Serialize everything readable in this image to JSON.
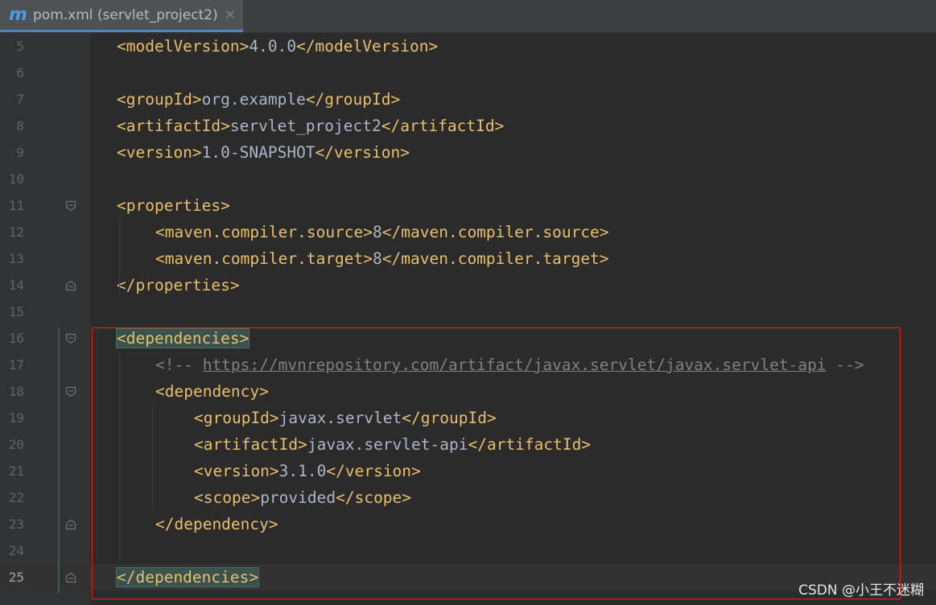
{
  "tab": {
    "icon": "m",
    "icon_name": "maven-file-icon",
    "title": "pom.xml (servlet_project2)",
    "close": "✕"
  },
  "editor": {
    "current_line": 25,
    "lines": [
      {
        "n": "5",
        "indent": 1,
        "fold": "",
        "tokens": [
          [
            "tag",
            "<modelVersion>"
          ],
          [
            "txt",
            "4.0.0"
          ],
          [
            "tag",
            "</modelVersion>"
          ]
        ]
      },
      {
        "n": "6",
        "indent": 0,
        "fold": "",
        "tokens": []
      },
      {
        "n": "7",
        "indent": 1,
        "fold": "",
        "tokens": [
          [
            "tag",
            "<groupId>"
          ],
          [
            "txt",
            "org.example"
          ],
          [
            "tag",
            "</groupId>"
          ]
        ]
      },
      {
        "n": "8",
        "indent": 1,
        "fold": "",
        "tokens": [
          [
            "tag",
            "<artifactId>"
          ],
          [
            "txt",
            "servlet_project2"
          ],
          [
            "tag",
            "</artifactId>"
          ]
        ]
      },
      {
        "n": "9",
        "indent": 1,
        "fold": "",
        "tokens": [
          [
            "tag",
            "<version>"
          ],
          [
            "txt",
            "1.0-SNAPSHOT"
          ],
          [
            "tag",
            "</version>"
          ]
        ]
      },
      {
        "n": "10",
        "indent": 0,
        "fold": "",
        "tokens": []
      },
      {
        "n": "11",
        "indent": 1,
        "fold": "open",
        "tokens": [
          [
            "tag",
            "<properties>"
          ]
        ]
      },
      {
        "n": "12",
        "indent": 2,
        "fold": "",
        "tokens": [
          [
            "tag",
            "<maven.compiler.source>"
          ],
          [
            "txt",
            "8"
          ],
          [
            "tag",
            "</maven.compiler.source>"
          ]
        ]
      },
      {
        "n": "13",
        "indent": 2,
        "fold": "",
        "tokens": [
          [
            "tag",
            "<maven.compiler.target>"
          ],
          [
            "txt",
            "8"
          ],
          [
            "tag",
            "</maven.compiler.target>"
          ]
        ]
      },
      {
        "n": "14",
        "indent": 1,
        "fold": "close",
        "tokens": [
          [
            "tag",
            "</properties>"
          ]
        ]
      },
      {
        "n": "15",
        "indent": 0,
        "fold": "",
        "tokens": []
      },
      {
        "n": "16",
        "indent": 1,
        "fold": "open",
        "tokens": [
          [
            "match",
            "<dependencies>"
          ]
        ]
      },
      {
        "n": "17",
        "indent": 2,
        "fold": "",
        "tokens": [
          [
            "cmt",
            "<!-- "
          ],
          [
            "url",
            "https://mvnrepository.com/artifact/javax.servlet/javax.servlet-api"
          ],
          [
            "cmt",
            " -->"
          ]
        ]
      },
      {
        "n": "18",
        "indent": 2,
        "fold": "open",
        "tokens": [
          [
            "tag",
            "<dependency>"
          ]
        ]
      },
      {
        "n": "19",
        "indent": 3,
        "fold": "",
        "tokens": [
          [
            "tag",
            "<groupId>"
          ],
          [
            "txt",
            "javax.servlet"
          ],
          [
            "tag",
            "</groupId>"
          ]
        ]
      },
      {
        "n": "20",
        "indent": 3,
        "fold": "",
        "tokens": [
          [
            "tag",
            "<artifactId>"
          ],
          [
            "txt",
            "javax.servlet-api"
          ],
          [
            "tag",
            "</artifactId>"
          ]
        ]
      },
      {
        "n": "21",
        "indent": 3,
        "fold": "",
        "tokens": [
          [
            "tag",
            "<version>"
          ],
          [
            "txt",
            "3.1.0"
          ],
          [
            "tag",
            "</version>"
          ]
        ]
      },
      {
        "n": "22",
        "indent": 3,
        "fold": "",
        "tokens": [
          [
            "tag",
            "<scope>"
          ],
          [
            "txt",
            "provided"
          ],
          [
            "tag",
            "</scope>"
          ]
        ]
      },
      {
        "n": "23",
        "indent": 2,
        "fold": "close",
        "tokens": [
          [
            "tag",
            "</dependency>"
          ]
        ]
      },
      {
        "n": "24",
        "indent": 0,
        "fold": "",
        "tokens": []
      },
      {
        "n": "25",
        "indent": 1,
        "fold": "close",
        "tokens": [
          [
            "match",
            "</dependencies>"
          ]
        ]
      }
    ]
  },
  "colors": {
    "tag": "#e8bf6a",
    "text": "#a9b7c6",
    "comment": "#808080",
    "highlight_box": "#e02424",
    "background": "#2b2b2b"
  },
  "watermark": "CSDN @小王不迷糊"
}
